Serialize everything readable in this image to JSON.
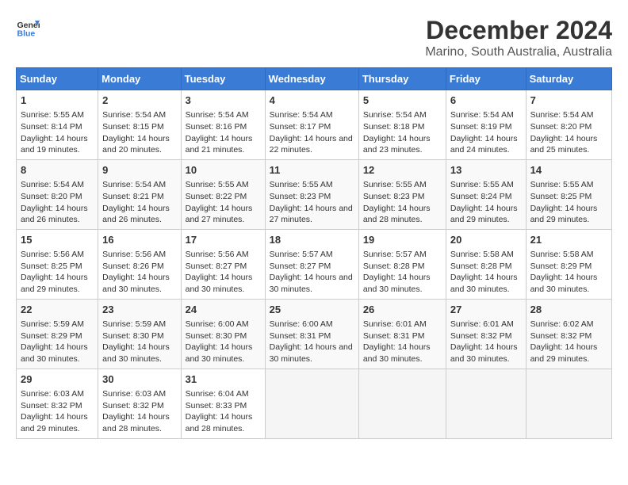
{
  "logo": {
    "line1": "General",
    "line2": "Blue"
  },
  "title": "December 2024",
  "subtitle": "Marino, South Australia, Australia",
  "days_of_week": [
    "Sunday",
    "Monday",
    "Tuesday",
    "Wednesday",
    "Thursday",
    "Friday",
    "Saturday"
  ],
  "weeks": [
    [
      {
        "day": 1,
        "sunrise": "5:55 AM",
        "sunset": "8:14 PM",
        "daylight": "14 hours and 19 minutes."
      },
      {
        "day": 2,
        "sunrise": "5:54 AM",
        "sunset": "8:15 PM",
        "daylight": "14 hours and 20 minutes."
      },
      {
        "day": 3,
        "sunrise": "5:54 AM",
        "sunset": "8:16 PM",
        "daylight": "14 hours and 21 minutes."
      },
      {
        "day": 4,
        "sunrise": "5:54 AM",
        "sunset": "8:17 PM",
        "daylight": "14 hours and 22 minutes."
      },
      {
        "day": 5,
        "sunrise": "5:54 AM",
        "sunset": "8:18 PM",
        "daylight": "14 hours and 23 minutes."
      },
      {
        "day": 6,
        "sunrise": "5:54 AM",
        "sunset": "8:19 PM",
        "daylight": "14 hours and 24 minutes."
      },
      {
        "day": 7,
        "sunrise": "5:54 AM",
        "sunset": "8:20 PM",
        "daylight": "14 hours and 25 minutes."
      }
    ],
    [
      {
        "day": 8,
        "sunrise": "5:54 AM",
        "sunset": "8:20 PM",
        "daylight": "14 hours and 26 minutes."
      },
      {
        "day": 9,
        "sunrise": "5:54 AM",
        "sunset": "8:21 PM",
        "daylight": "14 hours and 26 minutes."
      },
      {
        "day": 10,
        "sunrise": "5:55 AM",
        "sunset": "8:22 PM",
        "daylight": "14 hours and 27 minutes."
      },
      {
        "day": 11,
        "sunrise": "5:55 AM",
        "sunset": "8:23 PM",
        "daylight": "14 hours and 27 minutes."
      },
      {
        "day": 12,
        "sunrise": "5:55 AM",
        "sunset": "8:23 PM",
        "daylight": "14 hours and 28 minutes."
      },
      {
        "day": 13,
        "sunrise": "5:55 AM",
        "sunset": "8:24 PM",
        "daylight": "14 hours and 29 minutes."
      },
      {
        "day": 14,
        "sunrise": "5:55 AM",
        "sunset": "8:25 PM",
        "daylight": "14 hours and 29 minutes."
      }
    ],
    [
      {
        "day": 15,
        "sunrise": "5:56 AM",
        "sunset": "8:25 PM",
        "daylight": "14 hours and 29 minutes."
      },
      {
        "day": 16,
        "sunrise": "5:56 AM",
        "sunset": "8:26 PM",
        "daylight": "14 hours and 30 minutes."
      },
      {
        "day": 17,
        "sunrise": "5:56 AM",
        "sunset": "8:27 PM",
        "daylight": "14 hours and 30 minutes."
      },
      {
        "day": 18,
        "sunrise": "5:57 AM",
        "sunset": "8:27 PM",
        "daylight": "14 hours and 30 minutes."
      },
      {
        "day": 19,
        "sunrise": "5:57 AM",
        "sunset": "8:28 PM",
        "daylight": "14 hours and 30 minutes."
      },
      {
        "day": 20,
        "sunrise": "5:58 AM",
        "sunset": "8:28 PM",
        "daylight": "14 hours and 30 minutes."
      },
      {
        "day": 21,
        "sunrise": "5:58 AM",
        "sunset": "8:29 PM",
        "daylight": "14 hours and 30 minutes."
      }
    ],
    [
      {
        "day": 22,
        "sunrise": "5:59 AM",
        "sunset": "8:29 PM",
        "daylight": "14 hours and 30 minutes."
      },
      {
        "day": 23,
        "sunrise": "5:59 AM",
        "sunset": "8:30 PM",
        "daylight": "14 hours and 30 minutes."
      },
      {
        "day": 24,
        "sunrise": "6:00 AM",
        "sunset": "8:30 PM",
        "daylight": "14 hours and 30 minutes."
      },
      {
        "day": 25,
        "sunrise": "6:00 AM",
        "sunset": "8:31 PM",
        "daylight": "14 hours and 30 minutes."
      },
      {
        "day": 26,
        "sunrise": "6:01 AM",
        "sunset": "8:31 PM",
        "daylight": "14 hours and 30 minutes."
      },
      {
        "day": 27,
        "sunrise": "6:01 AM",
        "sunset": "8:32 PM",
        "daylight": "14 hours and 30 minutes."
      },
      {
        "day": 28,
        "sunrise": "6:02 AM",
        "sunset": "8:32 PM",
        "daylight": "14 hours and 29 minutes."
      }
    ],
    [
      {
        "day": 29,
        "sunrise": "6:03 AM",
        "sunset": "8:32 PM",
        "daylight": "14 hours and 29 minutes."
      },
      {
        "day": 30,
        "sunrise": "6:03 AM",
        "sunset": "8:32 PM",
        "daylight": "14 hours and 28 minutes."
      },
      {
        "day": 31,
        "sunrise": "6:04 AM",
        "sunset": "8:33 PM",
        "daylight": "14 hours and 28 minutes."
      },
      null,
      null,
      null,
      null
    ]
  ]
}
